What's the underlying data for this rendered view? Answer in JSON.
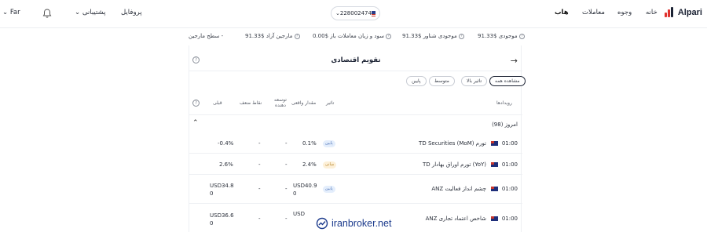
{
  "brand": {
    "name": "Alpari"
  },
  "nav": {
    "items": [
      "خانه",
      "وجوه",
      "معاملات",
      "هاب"
    ],
    "active": "هاب"
  },
  "account": {
    "number": "228002474"
  },
  "header_left": {
    "profile": "پروفایل",
    "support": "پشتیبانی",
    "language": "Far"
  },
  "status": [
    {
      "label": "موجودی",
      "value": "$91.33"
    },
    {
      "label": "موجودی شناور",
      "value": "$91.33"
    },
    {
      "label": "سود و زیان معاملات باز",
      "value": "$0.00"
    },
    {
      "label": "مارجین آزاد",
      "value": "$91.33"
    },
    {
      "label": "سطح مارجین",
      "value": "-"
    }
  ],
  "calendar": {
    "title": "تقویم اقتصادی",
    "filters": [
      "مشاهده همه",
      "تاثیر بالا",
      "متوسط",
      "پایین"
    ],
    "selected_filter": "مشاهده همه",
    "columns": [
      "رویدادها",
      "تاثیر",
      "مقدار واقعی",
      "توسعه دهنده",
      "نقاط ضعف",
      "قبلی"
    ],
    "day": {
      "label": "امروز (98)"
    },
    "rows": [
      {
        "time": "01:00",
        "event": "TD Securities (MoM) تورم",
        "impact": "پایین",
        "impact_level": "low",
        "actual": "0.1%",
        "forecast": "-",
        "consensus": "-",
        "previous": "-0.4%"
      },
      {
        "time": "01:00",
        "event": "TD تورم اوراق بهادار (YoY)",
        "impact": "میانی",
        "impact_level": "medium",
        "actual": "2.4%",
        "forecast": "-",
        "consensus": "-",
        "previous": "2.6%"
      },
      {
        "time": "01:00",
        "event": "ANZ چشم انداز فعالیت",
        "impact": "پایین",
        "impact_level": "low",
        "actual": "USD40.9\n0",
        "forecast": "-",
        "consensus": "-",
        "previous": "USD34.8\n0"
      },
      {
        "time": "01:00",
        "event": "ANZ شاخص اعتماد تجاری",
        "impact": "",
        "impact_level": "",
        "actual": "USD",
        "forecast": "-",
        "consensus": "-",
        "previous": "USD36.6\n0"
      }
    ]
  },
  "watermark": {
    "text": "iranbroker.net"
  },
  "colors": {
    "brand_blue": "#1b3a8c",
    "low_badge": "#4a6fb5",
    "medium_badge": "#b7862c"
  }
}
